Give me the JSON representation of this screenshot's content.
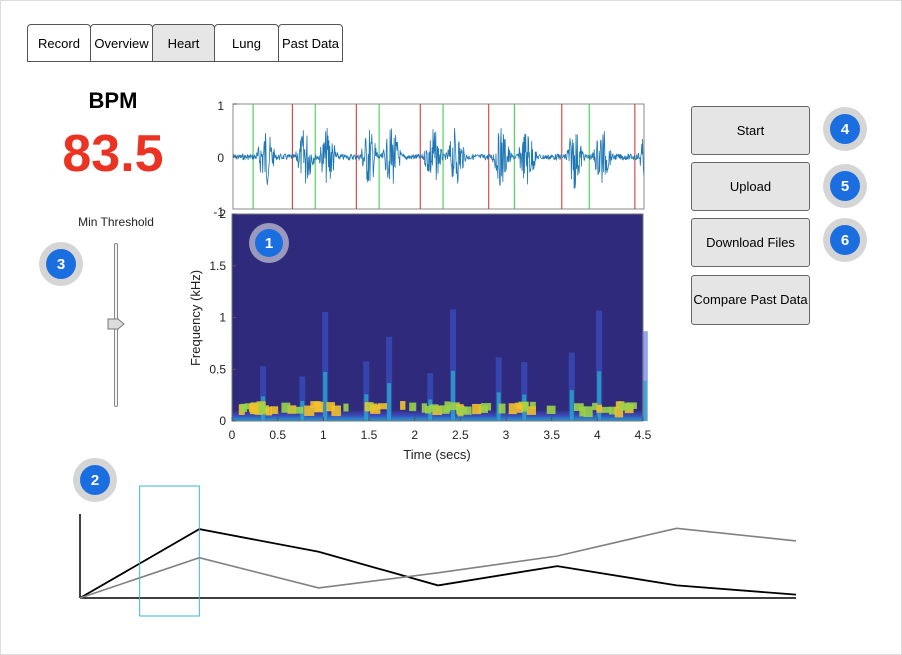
{
  "tabs": [
    {
      "label": "Record",
      "active": false
    },
    {
      "label": "Overview",
      "active": false
    },
    {
      "label": "Heart",
      "active": true
    },
    {
      "label": "Lung",
      "active": false
    },
    {
      "label": "Past Data",
      "active": false
    }
  ],
  "bpm": {
    "label": "BPM",
    "value": "83.5",
    "color": "#ea3323"
  },
  "threshold": {
    "label": "Min Threshold",
    "level": 0.5
  },
  "buttons": {
    "start": "Start",
    "upload": "Upload",
    "download": "Download Files",
    "compare": "Compare Past Data"
  },
  "markers": [
    "1",
    "2",
    "3",
    "4",
    "5",
    "6"
  ],
  "colors": {
    "accent": "#1a6ee0",
    "waveform": "#1f77b4",
    "peak_green": "#2ecc40",
    "peak_red": "#d62728",
    "spectrogram_bg": "#302a7d"
  },
  "waveform": {
    "yticks": [
      "1",
      "0",
      "-1"
    ],
    "green_lines_sec": [
      0.22,
      0.9,
      1.6,
      2.3,
      3.08,
      3.9
    ],
    "red_lines_sec": [
      0.65,
      1.35,
      2.05,
      2.8,
      3.6,
      4.4
    ]
  },
  "spectrogram": {
    "xlabel": "Time (secs)",
    "ylabel": "Frequency (kHz)",
    "xticks": [
      "0",
      "0.5",
      "1",
      "1.5",
      "2",
      "2.5",
      "3",
      "3.5",
      "4",
      "4.5"
    ],
    "yticks": [
      "0",
      "0.5",
      "1",
      "1.5",
      "2"
    ],
    "xlim": [
      0,
      4.5
    ],
    "ylim": [
      0,
      2
    ]
  },
  "chart_data": {
    "type": "line",
    "x": [
      0,
      1,
      2,
      3,
      4,
      5,
      6
    ],
    "series": [
      {
        "values": [
          0,
          82,
          55,
          15,
          38,
          15,
          4
        ],
        "color": "#000000"
      },
      {
        "values": [
          0,
          48,
          12,
          30,
          50,
          83,
          68
        ],
        "color": "#808080"
      }
    ],
    "selection": {
      "from": 0.5,
      "to": 1.0
    }
  }
}
